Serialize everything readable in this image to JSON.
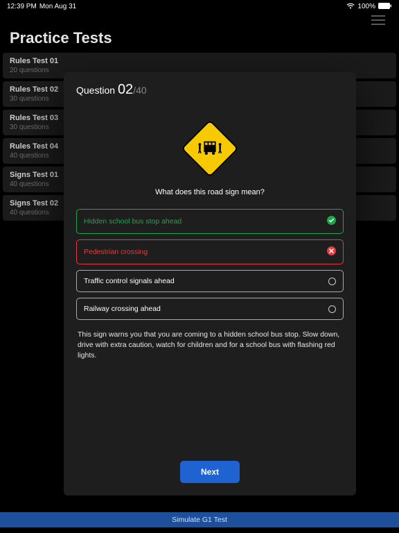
{
  "status_bar": {
    "time": "12:39 PM",
    "date": "Mon Aug 31",
    "battery_pct": "100%"
  },
  "hamburger_name": "menu-icon",
  "page_title": "Practice Tests",
  "tests": [
    {
      "title": "Rules Test 01",
      "sub": "20 questions"
    },
    {
      "title": "Rules Test 02",
      "sub": "30 questions"
    },
    {
      "title": "Rules Test 03",
      "sub": "30 questions"
    },
    {
      "title": "Rules Test 04",
      "sub": "40 questions"
    },
    {
      "title": "Signs Test 01",
      "sub": "40 questions"
    },
    {
      "title": "Signs Test 02",
      "sub": "40 questions"
    }
  ],
  "modal": {
    "q_label": "Question",
    "current": "02",
    "total": "/40",
    "question_text": "What does this road sign mean?",
    "answers": [
      {
        "text": "Hidden school bus stop ahead",
        "state": "correct"
      },
      {
        "text": "Pedestrian crossing",
        "state": "incorrect"
      },
      {
        "text": "Traffic control signals ahead",
        "state": "neutral"
      },
      {
        "text": "Railway crossing ahead",
        "state": "neutral"
      }
    ],
    "explanation": "This sign warns you that you are coming to a hidden school bus stop. Slow down, drive with extra caution, watch for children and for a school bus with flashing red lights.",
    "next_label": "Next"
  },
  "bottom_bar_label": "Simulate G1 Test"
}
